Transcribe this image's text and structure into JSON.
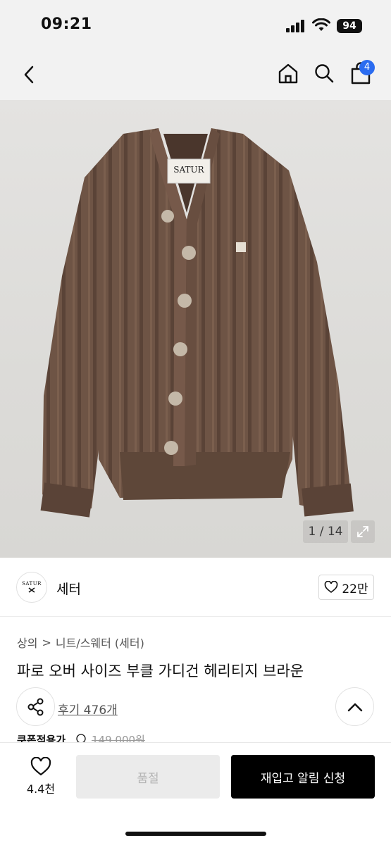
{
  "status_bar": {
    "time": "09:21",
    "battery": "94"
  },
  "nav": {
    "cart_count": "4"
  },
  "image": {
    "counter": "1 / 14",
    "tag_text": "SATUR"
  },
  "brand": {
    "logo_text": "SATUR",
    "name": "세터",
    "likes": "22만"
  },
  "breadcrumb": {
    "level1": "상의",
    "separator": ">",
    "level2": "니트/스웨터 (세터)"
  },
  "product": {
    "title": "파로 오버 사이즈 부클 가디건 헤리티지 브라운"
  },
  "reviews": {
    "link": "후기 476개"
  },
  "coupon": {
    "label": "쿠폰적용가",
    "price": "149,000원"
  },
  "bottom": {
    "wish_count": "4.4천",
    "soldout_label": "품절",
    "restock_label": "재입고 알림 신청"
  },
  "colors": {
    "accent_badge": "#2b6cf0",
    "primary_button": "#000000",
    "disabled_button": "#ebebeb",
    "sweater": "#6e5445"
  },
  "icons": [
    "chevron-left-icon",
    "home-icon",
    "search-icon",
    "cart-icon",
    "expand-icon",
    "heart-icon",
    "share-icon",
    "chevron-up-icon",
    "info-icon"
  ]
}
